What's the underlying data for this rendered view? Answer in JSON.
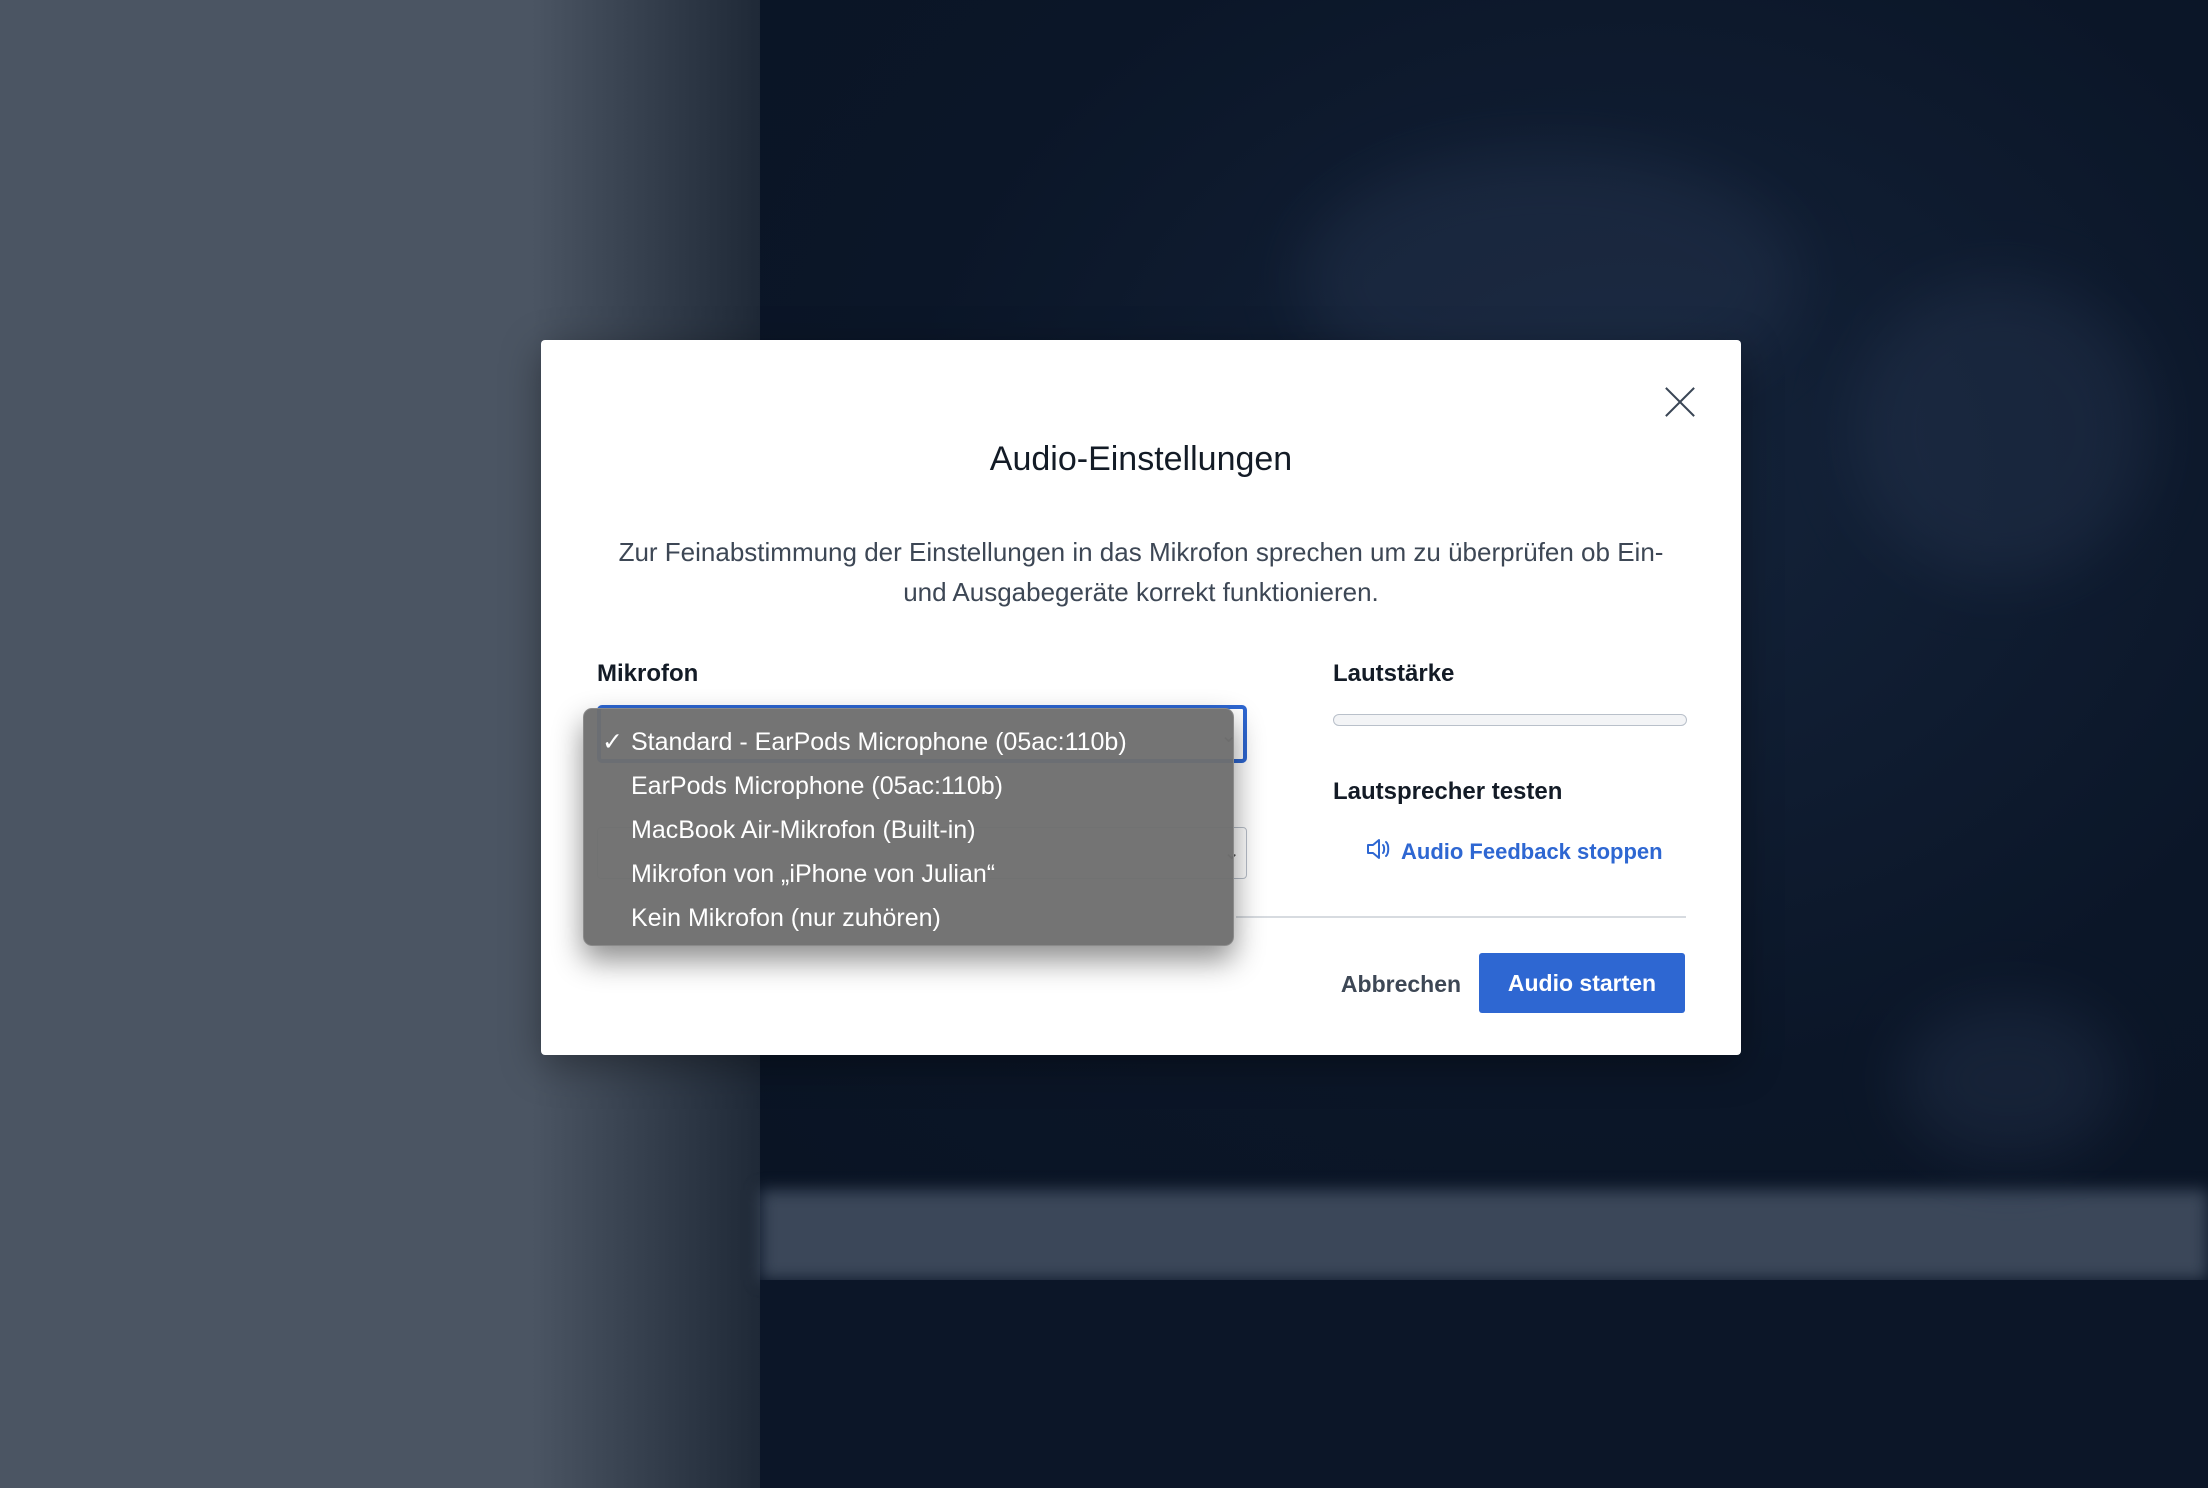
{
  "dialog": {
    "title": "Audio-Einstellungen",
    "description": "Zur Feinabstimmung der Einstellungen in das Mikrofon sprechen um zu überprüfen ob Ein- und Ausgabegeräte korrekt funktionieren.",
    "microphone_label": "Mikrofon",
    "volume_label": "Lautstärke",
    "volume_level": 0,
    "speaker_test_label": "Lautsprecher testen",
    "feedback_link": "Audio Feedback stoppen",
    "cancel_label": "Abbrechen",
    "start_label": "Audio starten",
    "accent_color": "#2e67d2"
  },
  "microphone_menu": {
    "items": [
      {
        "label": "Standard - EarPods Microphone (05ac:110b)",
        "selected": true
      },
      {
        "label": "EarPods Microphone (05ac:110b)",
        "selected": false
      },
      {
        "label": "MacBook Air-Mikrofon (Built-in)",
        "selected": false
      },
      {
        "label": "Mikrofon von „iPhone von Julian“",
        "selected": false
      },
      {
        "label": "Kein Mikrofon (nur zuhören)",
        "selected": false
      }
    ],
    "check_glyph": "✓"
  },
  "icons": {
    "close": "close-icon",
    "speaker": "speaker-icon",
    "chevron": "chevron-down-icon"
  }
}
